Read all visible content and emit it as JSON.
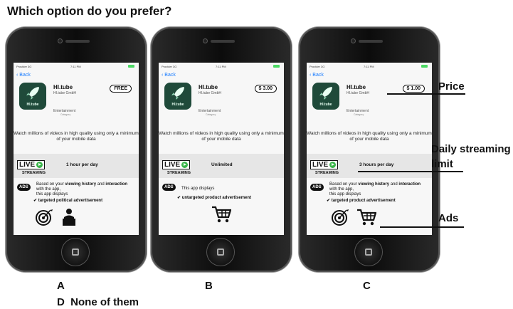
{
  "question": "Which option do you prefer?",
  "shared": {
    "carrier": "Provider 3G",
    "time": "7:11 PM",
    "back": "Back",
    "app_name": "HI.tube",
    "developer": "HI.tube GmbH",
    "icon_label": "HI.tube",
    "category": "Entertainment",
    "category_sub": "Category",
    "description": "Watch millions of videos in high quality using only a minimum of your mobile data",
    "live": "LIVE",
    "streaming": "STREAMING",
    "ads_badge": "ADS"
  },
  "options": {
    "a": {
      "letter": "A",
      "price": "FREE",
      "limit": "1 hour per day",
      "ads_text_html": "Based on your <b>viewing history</b> and <b>interaction</b> with the app,<br>this app displays",
      "ads_type": "targeted political advertisement"
    },
    "b": {
      "letter": "B",
      "price": "$ 3.00",
      "limit": "Unlimited",
      "ads_text_html": "This app displays",
      "ads_type": "untargeted product advertisement"
    },
    "c": {
      "letter": "C",
      "price": "$ 1.00",
      "limit": "3 hours per day",
      "ads_text_html": "Based on your <b>viewing history</b> and <b>interaction</b> with the app,<br>this app displays",
      "ads_type": "targeted product advertisement"
    }
  },
  "callouts": {
    "price": "Price",
    "limit_line1": "Daily streaming",
    "limit_line2": "limit",
    "ads": "Ads"
  },
  "none_option": "D  None of them",
  "colors": {
    "accent_blue": "#1a7cff",
    "live_green": "#3ab54a",
    "icon_bg": "#1f4a3a"
  }
}
